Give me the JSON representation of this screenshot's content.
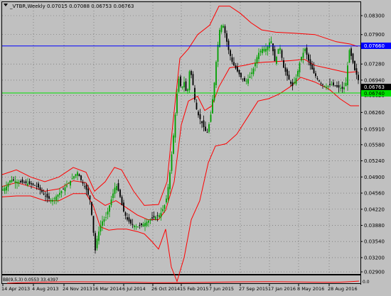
{
  "header": {
    "symbol_line": "_VTBR,Weekly  0.07015 0.07088 0.06753 0.06763"
  },
  "indicator": {
    "label": "BB(9,5,3) 0.0553 33.4397"
  },
  "price_tags": {
    "blue": "0.07660",
    "current": "0.06763",
    "green": "0.06740"
  },
  "colors": {
    "background": "#c0c0c0",
    "grid": "#000000",
    "bull": "#00a000",
    "bear": "#000000",
    "band": "#ff0000",
    "hline_blue": "#0000ff",
    "hline_green": "#00e000",
    "current_tag": "#000000"
  },
  "chart_data": {
    "type": "candlestick",
    "title": "_VTBR,Weekly",
    "y_ticks": [
      "0.08300",
      "0.07900",
      "0.07660",
      "0.07280",
      "0.06940",
      "0.06763",
      "0.06620",
      "0.06260",
      "0.05910",
      "0.05580",
      "0.05240",
      "0.04900",
      "0.04560",
      "0.04220",
      "0.03880",
      "0.03540",
      "0.03200",
      "0.02900"
    ],
    "x_ticks": [
      "14 Apr 2013",
      "4 Aug 2013",
      "24 Nov 2013",
      "16 Mar 2014",
      "6 Jul 2014",
      "26 Oct 2014",
      "15 Feb 2015",
      "7 Jun 2015",
      "27 Sep 2015",
      "17 Jan 2016",
      "8 May 2016",
      "28 Aug 2016"
    ],
    "hlines": {
      "blue": 0.0766,
      "green": 0.0667
    },
    "close_path": [
      [
        0,
        0.0462
      ],
      [
        6,
        0.047
      ],
      [
        12,
        0.0485
      ],
      [
        20,
        0.048
      ],
      [
        30,
        0.0478
      ],
      [
        40,
        0.0475
      ],
      [
        50,
        0.047
      ],
      [
        60,
        0.045
      ],
      [
        70,
        0.044
      ],
      [
        80,
        0.0455
      ],
      [
        90,
        0.047
      ],
      [
        100,
        0.049
      ],
      [
        106,
        0.05
      ],
      [
        112,
        0.048
      ],
      [
        118,
        0.0465
      ],
      [
        124,
        0.044
      ],
      [
        128,
        0.038
      ],
      [
        131,
        0.0335
      ],
      [
        134,
        0.0365
      ],
      [
        140,
        0.0395
      ],
      [
        146,
        0.0405
      ],
      [
        150,
        0.0425
      ],
      [
        155,
        0.045
      ],
      [
        160,
        0.0475
      ],
      [
        165,
        0.0455
      ],
      [
        170,
        0.042
      ],
      [
        176,
        0.04
      ],
      [
        182,
        0.039
      ],
      [
        190,
        0.0385
      ],
      [
        198,
        0.039
      ],
      [
        206,
        0.0398
      ],
      [
        214,
        0.0405
      ],
      [
        222,
        0.041
      ],
      [
        228,
        0.0428
      ],
      [
        232,
        0.045
      ],
      [
        236,
        0.05
      ],
      [
        240,
        0.056
      ],
      [
        244,
        0.063
      ],
      [
        248,
        0.07
      ],
      [
        252,
        0.0675
      ],
      [
        256,
        0.069
      ],
      [
        260,
        0.066
      ],
      [
        264,
        0.072
      ],
      [
        268,
        0.069
      ],
      [
        272,
        0.064
      ],
      [
        276,
        0.062
      ],
      [
        282,
        0.06
      ],
      [
        288,
        0.058
      ],
      [
        293,
        0.0615
      ],
      [
        298,
        0.068
      ],
      [
        302,
        0.075
      ],
      [
        306,
        0.08
      ],
      [
        310,
        0.0815
      ],
      [
        314,
        0.079
      ],
      [
        318,
        0.076
      ],
      [
        324,
        0.073
      ],
      [
        330,
        0.0715
      ],
      [
        336,
        0.07
      ],
      [
        342,
        0.069
      ],
      [
        348,
        0.07
      ],
      [
        354,
        0.072
      ],
      [
        360,
        0.075
      ],
      [
        366,
        0.076
      ],
      [
        372,
        0.076
      ],
      [
        378,
        0.078
      ],
      [
        384,
        0.073
      ],
      [
        390,
        0.077
      ],
      [
        396,
        0.072
      ],
      [
        402,
        0.07
      ],
      [
        408,
        0.068
      ],
      [
        414,
        0.07
      ],
      [
        420,
        0.074
      ],
      [
        426,
        0.076
      ],
      [
        432,
        0.073
      ],
      [
        438,
        0.071
      ],
      [
        444,
        0.0695
      ],
      [
        450,
        0.0685
      ],
      [
        456,
        0.068
      ],
      [
        462,
        0.0685
      ],
      [
        468,
        0.0682
      ],
      [
        474,
        0.0678
      ],
      [
        480,
        0.0675
      ],
      [
        484,
        0.069
      ],
      [
        488,
        0.076
      ],
      [
        492,
        0.074
      ],
      [
        496,
        0.0715
      ],
      [
        500,
        0.07
      ],
      [
        504,
        0.0676
      ]
    ],
    "bands": {
      "upper": [
        [
          0,
          0.0495
        ],
        [
          20,
          0.0505
        ],
        [
          40,
          0.049
        ],
        [
          60,
          0.048
        ],
        [
          80,
          0.049
        ],
        [
          100,
          0.051
        ],
        [
          118,
          0.05
        ],
        [
          130,
          0.046
        ],
        [
          145,
          0.048
        ],
        [
          158,
          0.051
        ],
        [
          168,
          0.0505
        ],
        [
          185,
          0.046
        ],
        [
          200,
          0.043
        ],
        [
          220,
          0.0432
        ],
        [
          232,
          0.048
        ],
        [
          240,
          0.06
        ],
        [
          250,
          0.074
        ],
        [
          262,
          0.076
        ],
        [
          275,
          0.079
        ],
        [
          292,
          0.081
        ],
        [
          305,
          0.085
        ],
        [
          320,
          0.085
        ],
        [
          335,
          0.0835
        ],
        [
          350,
          0.0815
        ],
        [
          365,
          0.08
        ],
        [
          385,
          0.0795
        ],
        [
          410,
          0.0793
        ],
        [
          440,
          0.079
        ],
        [
          470,
          0.0775
        ],
        [
          490,
          0.077
        ],
        [
          500,
          0.0765
        ]
      ],
      "middle": [
        [
          0,
          0.047
        ],
        [
          20,
          0.0478
        ],
        [
          40,
          0.047
        ],
        [
          60,
          0.046
        ],
        [
          80,
          0.0465
        ],
        [
          100,
          0.0482
        ],
        [
          118,
          0.0478
        ],
        [
          130,
          0.0445
        ],
        [
          145,
          0.043
        ],
        [
          160,
          0.044
        ],
        [
          175,
          0.0425
        ],
        [
          190,
          0.041
        ],
        [
          205,
          0.04
        ],
        [
          220,
          0.04
        ],
        [
          230,
          0.042
        ],
        [
          242,
          0.048
        ],
        [
          252,
          0.06
        ],
        [
          262,
          0.065
        ],
        [
          275,
          0.066
        ],
        [
          285,
          0.063
        ],
        [
          295,
          0.064
        ],
        [
          305,
          0.068
        ],
        [
          320,
          0.072
        ],
        [
          340,
          0.0725
        ],
        [
          355,
          0.073
        ],
        [
          370,
          0.0732
        ],
        [
          385,
          0.0733
        ],
        [
          405,
          0.0735
        ],
        [
          425,
          0.0738
        ],
        [
          440,
          0.0725
        ],
        [
          455,
          0.072
        ],
        [
          470,
          0.0715
        ],
        [
          485,
          0.071
        ],
        [
          500,
          0.0712
        ]
      ],
      "lower": [
        [
          0,
          0.0448
        ],
        [
          20,
          0.045
        ],
        [
          40,
          0.045
        ],
        [
          60,
          0.044
        ],
        [
          80,
          0.044
        ],
        [
          100,
          0.0455
        ],
        [
          118,
          0.0455
        ],
        [
          128,
          0.043
        ],
        [
          138,
          0.0385
        ],
        [
          150,
          0.0378
        ],
        [
          162,
          0.038
        ],
        [
          175,
          0.038
        ],
        [
          190,
          0.0375
        ],
        [
          200,
          0.037
        ],
        [
          210,
          0.0355
        ],
        [
          220,
          0.0338
        ],
        [
          230,
          0.038
        ],
        [
          238,
          0.03
        ],
        [
          246,
          0.027
        ],
        [
          256,
          0.032
        ],
        [
          266,
          0.04
        ],
        [
          278,
          0.044
        ],
        [
          290,
          0.052
        ],
        [
          300,
          0.0555
        ],
        [
          315,
          0.056
        ],
        [
          330,
          0.058
        ],
        [
          345,
          0.0615
        ],
        [
          360,
          0.065
        ],
        [
          375,
          0.0655
        ],
        [
          390,
          0.0665
        ],
        [
          405,
          0.068
        ],
        [
          420,
          0.07
        ],
        [
          440,
          0.069
        ],
        [
          460,
          0.0675
        ],
        [
          475,
          0.0655
        ],
        [
          490,
          0.064
        ],
        [
          502,
          0.064
        ]
      ]
    }
  }
}
